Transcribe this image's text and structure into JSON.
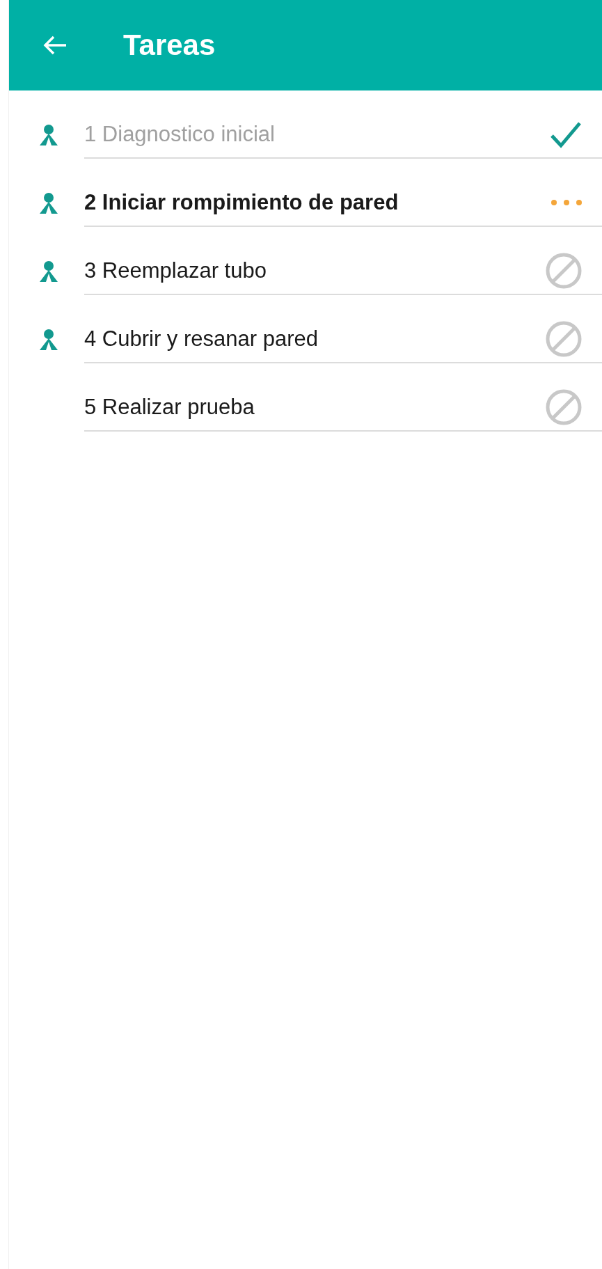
{
  "app_bar": {
    "title": "Tareas"
  },
  "tasks": [
    {
      "label": "1 Diagnostico inicial",
      "assigned": true,
      "kind": "done"
    },
    {
      "label": "2 Iniciar rompimiento de pared",
      "assigned": true,
      "kind": "in_progress"
    },
    {
      "label": "3 Reemplazar tubo",
      "assigned": true,
      "kind": "blocked"
    },
    {
      "label": "4 Cubrir y resanar pared",
      "assigned": true,
      "kind": "blocked"
    },
    {
      "label": "5 Realizar prueba",
      "assigned": false,
      "kind": "blocked"
    }
  ]
}
